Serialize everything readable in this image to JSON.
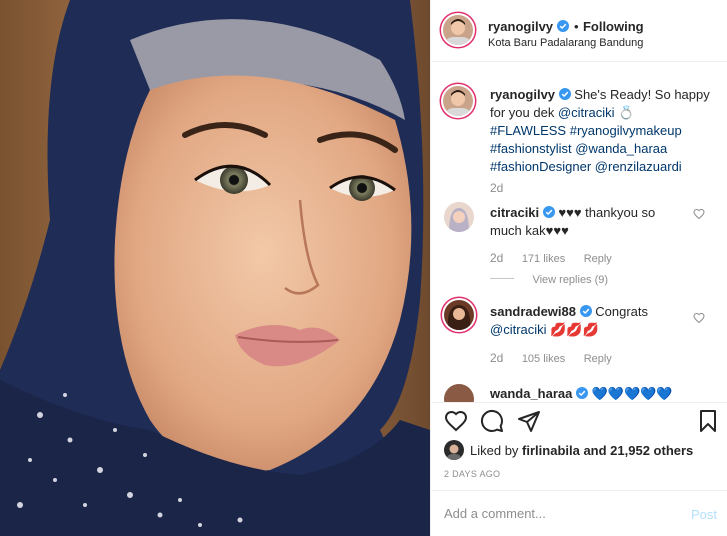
{
  "post": {
    "image_alt": "Portrait photo",
    "header": {
      "username": "ryanogilvy",
      "separator": "•",
      "follow_status": "Following",
      "location": "Kota Baru Padalarang Bandung"
    },
    "caption": {
      "username": "ryanogilvy",
      "line1": "She's Ready! So happy",
      "line2_prefix": "for you dek ",
      "mention1": "@citraciki",
      "emoji1": "💍",
      "line3": "#FLAWLESS #ryanogilvymakeup",
      "line4": "#fashionstylist @wanda_haraa",
      "line5": "#fashionDesigner @renzilazuardi",
      "age": "2d"
    },
    "comments": [
      {
        "username": "citraciki",
        "text1": "♥♥♥ thankyou so",
        "text2": "much kak♥♥♥",
        "age": "2d",
        "likes": "171 likes",
        "reply": "Reply",
        "view_replies": "View replies (9)"
      },
      {
        "username": "sandradewi88",
        "text1": "Congrats",
        "mention": "@citraciki",
        "emoji": "💋💋💋",
        "age": "2d",
        "likes": "105 likes",
        "reply": "Reply"
      },
      {
        "username": "wanda_haraa",
        "text1": "💙💙💙💙💙"
      }
    ],
    "likes": {
      "prefix": "Liked by ",
      "user": "firlinabila",
      "suffix": " and 21,952 others"
    },
    "timestamp": "2 DAYS AGO",
    "comment_box": {
      "placeholder": "Add a comment...",
      "post_label": "Post"
    }
  },
  "colors": {
    "accent": "#0095f6",
    "text": "#262626",
    "muted": "#8e8e8e",
    "link": "#00376b",
    "hijab": "#1f2c55",
    "kiss": "#c8102e"
  }
}
